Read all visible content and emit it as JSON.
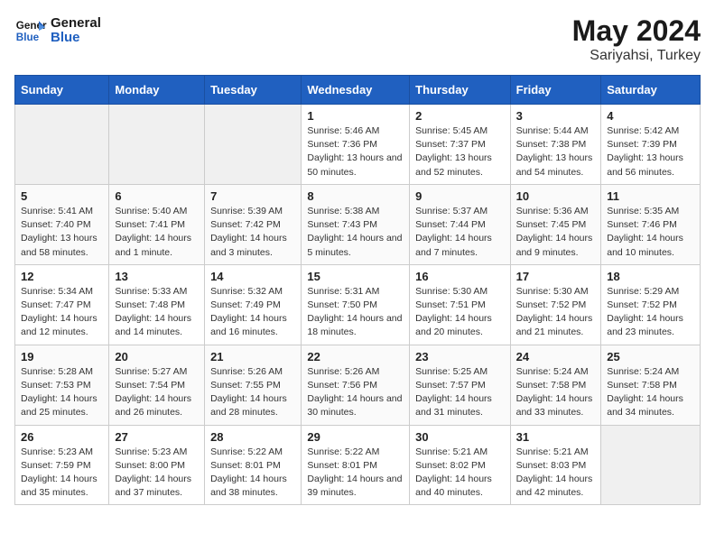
{
  "header": {
    "logo_line1": "General",
    "logo_line2": "Blue",
    "month_year": "May 2024",
    "location": "Sariyahsi, Turkey"
  },
  "weekdays": [
    "Sunday",
    "Monday",
    "Tuesday",
    "Wednesday",
    "Thursday",
    "Friday",
    "Saturday"
  ],
  "weeks": [
    [
      {
        "day": "",
        "empty": true
      },
      {
        "day": "",
        "empty": true
      },
      {
        "day": "",
        "empty": true
      },
      {
        "day": "1",
        "sunrise": "Sunrise: 5:46 AM",
        "sunset": "Sunset: 7:36 PM",
        "daylight": "Daylight: 13 hours and 50 minutes."
      },
      {
        "day": "2",
        "sunrise": "Sunrise: 5:45 AM",
        "sunset": "Sunset: 7:37 PM",
        "daylight": "Daylight: 13 hours and 52 minutes."
      },
      {
        "day": "3",
        "sunrise": "Sunrise: 5:44 AM",
        "sunset": "Sunset: 7:38 PM",
        "daylight": "Daylight: 13 hours and 54 minutes."
      },
      {
        "day": "4",
        "sunrise": "Sunrise: 5:42 AM",
        "sunset": "Sunset: 7:39 PM",
        "daylight": "Daylight: 13 hours and 56 minutes."
      }
    ],
    [
      {
        "day": "5",
        "sunrise": "Sunrise: 5:41 AM",
        "sunset": "Sunset: 7:40 PM",
        "daylight": "Daylight: 13 hours and 58 minutes."
      },
      {
        "day": "6",
        "sunrise": "Sunrise: 5:40 AM",
        "sunset": "Sunset: 7:41 PM",
        "daylight": "Daylight: 14 hours and 1 minute."
      },
      {
        "day": "7",
        "sunrise": "Sunrise: 5:39 AM",
        "sunset": "Sunset: 7:42 PM",
        "daylight": "Daylight: 14 hours and 3 minutes."
      },
      {
        "day": "8",
        "sunrise": "Sunrise: 5:38 AM",
        "sunset": "Sunset: 7:43 PM",
        "daylight": "Daylight: 14 hours and 5 minutes."
      },
      {
        "day": "9",
        "sunrise": "Sunrise: 5:37 AM",
        "sunset": "Sunset: 7:44 PM",
        "daylight": "Daylight: 14 hours and 7 minutes."
      },
      {
        "day": "10",
        "sunrise": "Sunrise: 5:36 AM",
        "sunset": "Sunset: 7:45 PM",
        "daylight": "Daylight: 14 hours and 9 minutes."
      },
      {
        "day": "11",
        "sunrise": "Sunrise: 5:35 AM",
        "sunset": "Sunset: 7:46 PM",
        "daylight": "Daylight: 14 hours and 10 minutes."
      }
    ],
    [
      {
        "day": "12",
        "sunrise": "Sunrise: 5:34 AM",
        "sunset": "Sunset: 7:47 PM",
        "daylight": "Daylight: 14 hours and 12 minutes."
      },
      {
        "day": "13",
        "sunrise": "Sunrise: 5:33 AM",
        "sunset": "Sunset: 7:48 PM",
        "daylight": "Daylight: 14 hours and 14 minutes."
      },
      {
        "day": "14",
        "sunrise": "Sunrise: 5:32 AM",
        "sunset": "Sunset: 7:49 PM",
        "daylight": "Daylight: 14 hours and 16 minutes."
      },
      {
        "day": "15",
        "sunrise": "Sunrise: 5:31 AM",
        "sunset": "Sunset: 7:50 PM",
        "daylight": "Daylight: 14 hours and 18 minutes."
      },
      {
        "day": "16",
        "sunrise": "Sunrise: 5:30 AM",
        "sunset": "Sunset: 7:51 PM",
        "daylight": "Daylight: 14 hours and 20 minutes."
      },
      {
        "day": "17",
        "sunrise": "Sunrise: 5:30 AM",
        "sunset": "Sunset: 7:52 PM",
        "daylight": "Daylight: 14 hours and 21 minutes."
      },
      {
        "day": "18",
        "sunrise": "Sunrise: 5:29 AM",
        "sunset": "Sunset: 7:52 PM",
        "daylight": "Daylight: 14 hours and 23 minutes."
      }
    ],
    [
      {
        "day": "19",
        "sunrise": "Sunrise: 5:28 AM",
        "sunset": "Sunset: 7:53 PM",
        "daylight": "Daylight: 14 hours and 25 minutes."
      },
      {
        "day": "20",
        "sunrise": "Sunrise: 5:27 AM",
        "sunset": "Sunset: 7:54 PM",
        "daylight": "Daylight: 14 hours and 26 minutes."
      },
      {
        "day": "21",
        "sunrise": "Sunrise: 5:26 AM",
        "sunset": "Sunset: 7:55 PM",
        "daylight": "Daylight: 14 hours and 28 minutes."
      },
      {
        "day": "22",
        "sunrise": "Sunrise: 5:26 AM",
        "sunset": "Sunset: 7:56 PM",
        "daylight": "Daylight: 14 hours and 30 minutes."
      },
      {
        "day": "23",
        "sunrise": "Sunrise: 5:25 AM",
        "sunset": "Sunset: 7:57 PM",
        "daylight": "Daylight: 14 hours and 31 minutes."
      },
      {
        "day": "24",
        "sunrise": "Sunrise: 5:24 AM",
        "sunset": "Sunset: 7:58 PM",
        "daylight": "Daylight: 14 hours and 33 minutes."
      },
      {
        "day": "25",
        "sunrise": "Sunrise: 5:24 AM",
        "sunset": "Sunset: 7:58 PM",
        "daylight": "Daylight: 14 hours and 34 minutes."
      }
    ],
    [
      {
        "day": "26",
        "sunrise": "Sunrise: 5:23 AM",
        "sunset": "Sunset: 7:59 PM",
        "daylight": "Daylight: 14 hours and 35 minutes."
      },
      {
        "day": "27",
        "sunrise": "Sunrise: 5:23 AM",
        "sunset": "Sunset: 8:00 PM",
        "daylight": "Daylight: 14 hours and 37 minutes."
      },
      {
        "day": "28",
        "sunrise": "Sunrise: 5:22 AM",
        "sunset": "Sunset: 8:01 PM",
        "daylight": "Daylight: 14 hours and 38 minutes."
      },
      {
        "day": "29",
        "sunrise": "Sunrise: 5:22 AM",
        "sunset": "Sunset: 8:01 PM",
        "daylight": "Daylight: 14 hours and 39 minutes."
      },
      {
        "day": "30",
        "sunrise": "Sunrise: 5:21 AM",
        "sunset": "Sunset: 8:02 PM",
        "daylight": "Daylight: 14 hours and 40 minutes."
      },
      {
        "day": "31",
        "sunrise": "Sunrise: 5:21 AM",
        "sunset": "Sunset: 8:03 PM",
        "daylight": "Daylight: 14 hours and 42 minutes."
      },
      {
        "day": "",
        "empty": true
      }
    ]
  ]
}
